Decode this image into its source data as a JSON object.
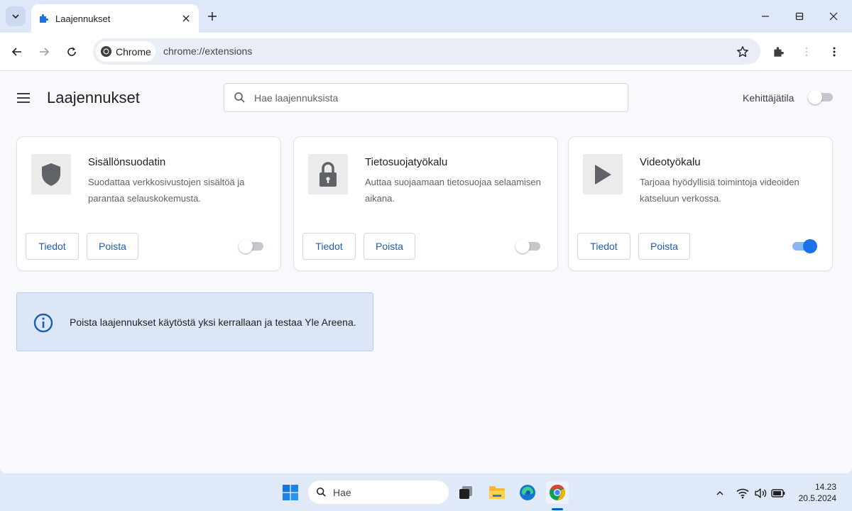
{
  "browser": {
    "tab_title": "Laajennukset",
    "chip_label": "Chrome",
    "url": "chrome://extensions"
  },
  "page": {
    "title": "Laajennukset",
    "search_placeholder": "Hae laajennuksista",
    "developer_mode_label": "Kehittäjätila",
    "developer_mode_on": false
  },
  "extensions": [
    {
      "name": "Sisällönsuodatin",
      "description": "Suodattaa verkkosivustojen sisältöä ja parantaa selauskokemusta.",
      "icon": "shield-icon",
      "details_label": "Tiedot",
      "remove_label": "Poista",
      "enabled": false
    },
    {
      "name": "Tietosuojatyökalu",
      "description": "Auttaa suojaamaan tietosuojaa selaamisen aikana.",
      "icon": "lock-icon",
      "details_label": "Tiedot",
      "remove_label": "Poista",
      "enabled": false
    },
    {
      "name": "Videotyökalu",
      "description": "Tarjoaa hyödyllisiä toimintoja videoiden katseluun verkossa.",
      "icon": "play-icon",
      "details_label": "Tiedot",
      "remove_label": "Poista",
      "enabled": true
    }
  ],
  "info_banner": {
    "text": "Poista laajennukset käytöstä yksi kerrallaan ja testaa Yle Areena."
  },
  "taskbar": {
    "search_label": "Hae",
    "time": "14.23",
    "date": "20.5.2024"
  },
  "colors": {
    "accent": "#1a73e8",
    "button_text": "#1a5fb4",
    "info_background": "#dde6f6"
  }
}
